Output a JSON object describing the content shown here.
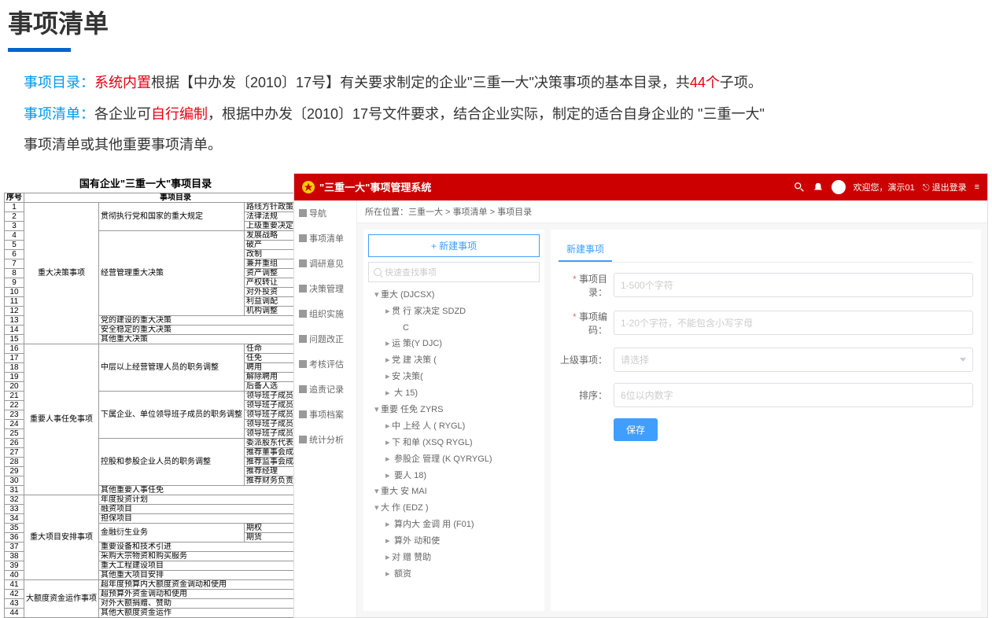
{
  "header": {
    "title": "事项清单",
    "line1_label": "事项目录：",
    "line1_red1": "系统内置",
    "line1_mid": "根据【中办发〔2010〕17号】有关要求制定的企业\"三重一大\"决策事项的基本目录，共",
    "line1_red2": "44个",
    "line1_end": "子项。",
    "line2_label": "事项清单：",
    "line2_a": "各企业可",
    "line2_red": "自行编制",
    "line2_b": "，根据中办发〔2010〕17号文件要求，结合企业实际，制定的适合自身企业的 \"三重一大\"",
    "line2_c": "事项清单或其他重要事项清单。"
  },
  "dir": {
    "title": "国有企业\"三重一大\"事项目录",
    "col1": "序号",
    "col2": "事项目录",
    "cats": {
      "a": "重大决策事项",
      "b": "重要人事任免事项",
      "c": "重大项目安排事项",
      "d": "大额度资金运作事项"
    },
    "subs": {
      "a1": "贯彻执行党和国家的重大规定",
      "a2": "经营管理重大决策",
      "a3": "党的建设的重大决策",
      "a4": "安全稳定的重大决策",
      "a5": "其他重大决策",
      "b1": "中层以上经营管理人员的职务调整",
      "b2": "下属企业、单位领导班子成员的职务调整",
      "b3": "控股和参股企业人员的职务调整",
      "b4": "其他重要人事任免",
      "c1": "年度投资计划",
      "c2": "融资项目",
      "c3": "担保项目",
      "c4": "金融衍生业务",
      "c5": "重要设备和技术引进",
      "c6": "采购大宗物资和购买服务",
      "c7": "重大工程建设项目",
      "c8": "其他重大项目安排",
      "d1": "超年度预算内大额度资金调动和使用",
      "d2": "超预算外资金调动和使用",
      "d3": "对外大额捐赠、赞助",
      "d4": "其他大额度资金运作"
    },
    "items": [
      "路线方针政策",
      "法律法规",
      "上级重要决定",
      "发展战略",
      "破产",
      "改制",
      "兼并重组",
      "资产调整",
      "产权转让",
      "对外投资",
      "利益调配",
      "机构调整",
      "",
      "",
      "",
      "任命",
      "任免",
      "聘用",
      "解除聘用",
      "后备人选",
      "领导班子成员任命",
      "领导班子成员任免",
      "领导班子成员聘用",
      "领导班子成员解除聘用",
      "领导班子成员后备人选",
      "委派股东代表",
      "推荐董事会成员",
      "推荐监事会成员",
      "推荐经理",
      "推荐财务负责人",
      "",
      "",
      "",
      "",
      "期权",
      "期货",
      "",
      "",
      "",
      "",
      "",
      "",
      "",
      "",
      ""
    ]
  },
  "app": {
    "title": "\"三重一大\"事项管理系统",
    "welcome": "欢迎您，演示01",
    "logout": "退出登录",
    "sidebar": [
      "导航",
      "事项清单",
      "调研意见",
      "决策管理",
      "组织实施",
      "问题改正",
      "考核评估",
      "追责记录",
      "事项档案",
      "统计分析"
    ],
    "breadcrumb_label": "所在位置：",
    "breadcrumb": "三重一大 > 事项清单 > 事项目录",
    "new_btn": "+ 新建事项",
    "search_placeholder": "快速查找事项",
    "tree": [
      {
        "lv": 0,
        "exp": "▾",
        "text": "重大          (DJCSX)"
      },
      {
        "lv": 1,
        "exp": "▸",
        "text": "贯    行    家决定              SDZD"
      },
      {
        "lv": 2,
        "exp": "",
        "text": "C"
      },
      {
        "lv": 1,
        "exp": "▸",
        "text": "运          策(Y    DJC)"
      },
      {
        "lv": 1,
        "exp": "▸",
        "text": "党  建  决策 ("
      },
      {
        "lv": 1,
        "exp": "▸",
        "text": "安          决策("
      },
      {
        "lv": 1,
        "exp": "▸",
        "text": "     大       15)"
      },
      {
        "lv": 0,
        "exp": "▾",
        "text": "重要     任免  ZYRS"
      },
      {
        "lv": 1,
        "exp": "▸",
        "text": "中    上经     人 (        RYGL)"
      },
      {
        "lv": 1,
        "exp": "▸",
        "text": "下      和单     (XSQ    RYGL)"
      },
      {
        "lv": 1,
        "exp": "▸",
        "text": "     参股企       管理 (K    QYRYGL)"
      },
      {
        "lv": 1,
        "exp": "▸",
        "text": "    要人     18)"
      },
      {
        "lv": 0,
        "exp": "▾",
        "text": "重大   安       MAI"
      },
      {
        "lv": 0,
        "exp": "▾",
        "text": "大      作     (EDZ     )"
      },
      {
        "lv": 1,
        "exp": "▸",
        "text": "     算内大  金调     用 (F01)"
      },
      {
        "lv": 1,
        "exp": "▸",
        "text": "     算外   动和使"
      },
      {
        "lv": 1,
        "exp": "▸",
        "text": "对    赠  赞助"
      },
      {
        "lv": 1,
        "exp": "▸",
        "text": "     额资"
      }
    ],
    "form": {
      "tab": "新建事项",
      "f1_label": "事项目录：",
      "f1_ph": "1-500个字符",
      "f2_label": "事项编码：",
      "f2_ph": "1-20个字符，不能包含小写字母",
      "f3_label": "上级事项：",
      "f3_ph": "请选择",
      "f4_label": "排序：",
      "f4_ph": "6位以内数字",
      "save": "保存"
    }
  }
}
